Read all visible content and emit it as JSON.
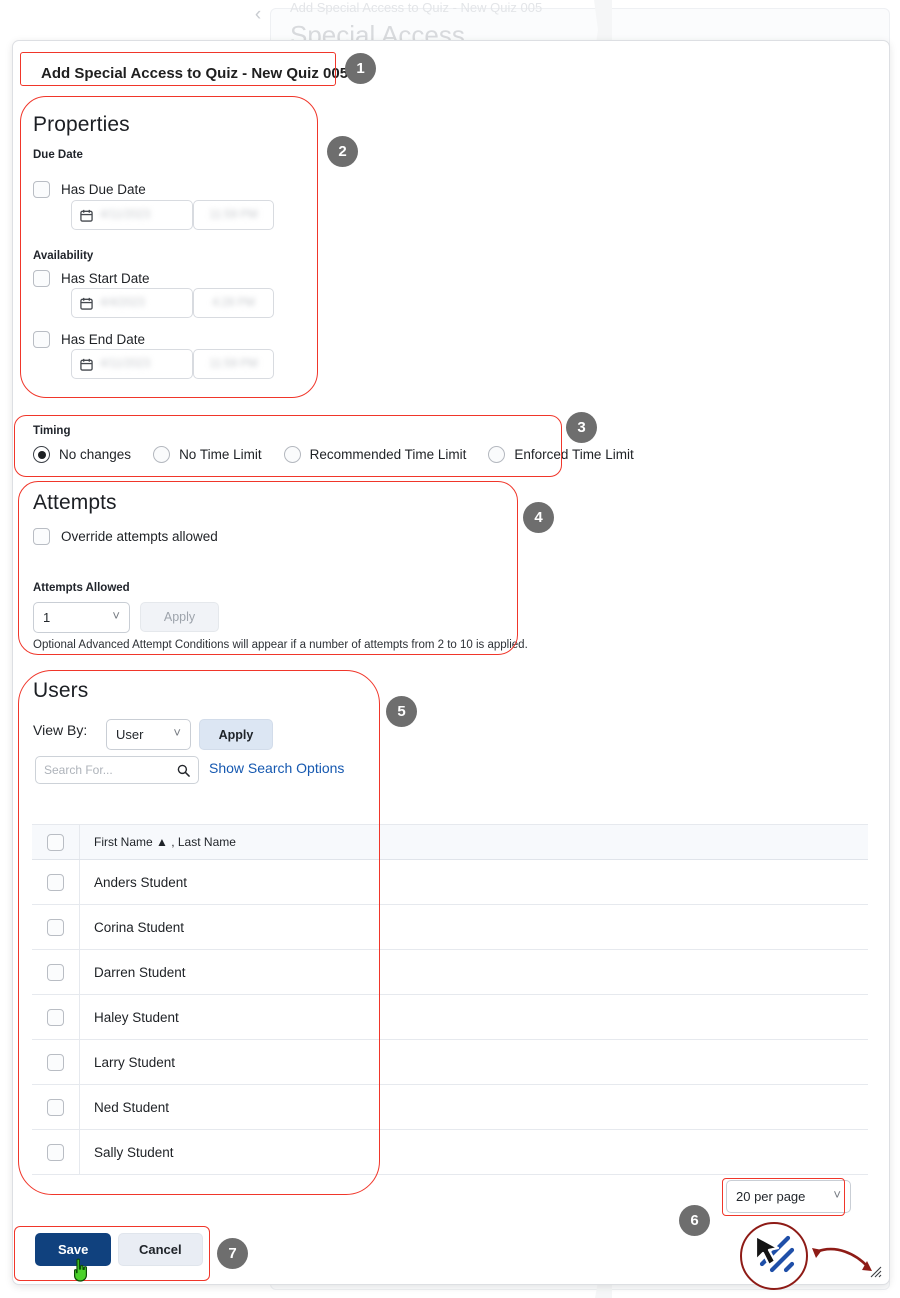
{
  "background": {
    "breadcrumb_faint": "Add Special Access to Quiz - New Quiz 005",
    "page_title": "Special Access",
    "back_chevron_icon": "chevron-left-icon"
  },
  "modal": {
    "title": "Add Special Access to Quiz - New Quiz 005",
    "close_icon": "close-icon",
    "resize_grip_icon": "resize-grip-icon"
  },
  "properties": {
    "heading": "Properties",
    "due_date_label": "Due Date",
    "has_due_date_label": "Has Due Date",
    "due_date_value": "4/11/2023",
    "due_time_value": "11:59 PM",
    "availability_label": "Availability",
    "has_start_date_label": "Has Start Date",
    "start_date_value": "4/4/2023",
    "start_time_value": "4:28 PM",
    "has_end_date_label": "Has End Date",
    "end_date_value": "4/11/2023",
    "end_time_value": "11:59 PM",
    "calendar_icon": "calendar-icon"
  },
  "timing": {
    "label": "Timing",
    "selected": "No changes",
    "options": [
      "No changes",
      "No Time Limit",
      "Recommended Time Limit",
      "Enforced Time Limit"
    ]
  },
  "attempts": {
    "heading": "Attempts",
    "override_label": "Override attempts allowed",
    "attempts_allowed_label": "Attempts Allowed",
    "attempts_value": "1",
    "apply_label": "Apply",
    "helper_text": "Optional Advanced Attempt Conditions will appear if a number of attempts from 2 to 10 is applied."
  },
  "users": {
    "heading": "Users",
    "view_by_label": "View By:",
    "view_by_value": "User",
    "apply_label": "Apply",
    "search_placeholder": "Search For...",
    "search_icon": "search-icon",
    "show_search_options": "Show Search Options",
    "table": {
      "header": "First Name ▲ , Last Name",
      "sort_icon": "sort-ascending-icon",
      "rows": [
        "Anders Student",
        "Corina Student",
        "Darren Student",
        "Haley Student",
        "Larry Student",
        "Ned Student",
        "Sally Student"
      ]
    },
    "per_page_value": "20 per page"
  },
  "footer": {
    "save_label": "Save",
    "cancel_label": "Cancel",
    "cursor_icon": "pointing-hand-cursor-icon"
  },
  "annotations": {
    "badges": [
      "1",
      "2",
      "3",
      "4",
      "5",
      "6",
      "7"
    ],
    "accent_color": "#f0362a",
    "badge_color": "#6e6e6e",
    "magnifier_icon": "resize-arrow-magnifier-icon",
    "resize_arrow_icon": "double-arrow-icon"
  }
}
